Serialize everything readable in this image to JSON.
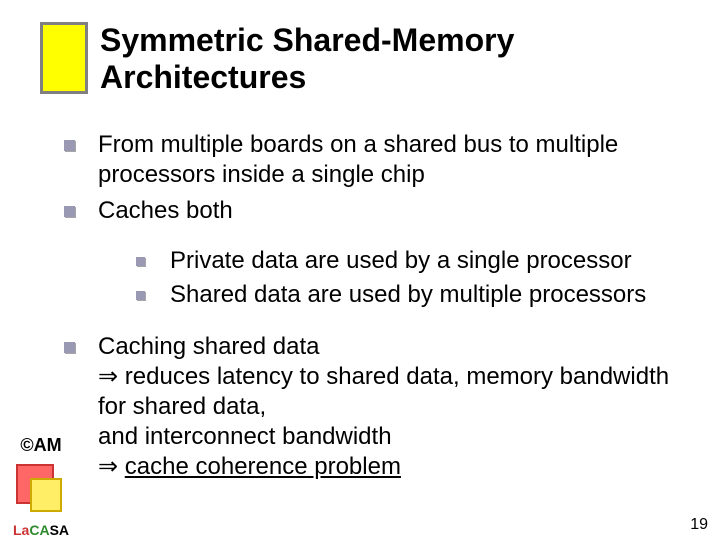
{
  "title": "Symmetric Shared-Memory Architectures",
  "bullets": {
    "b1": "From multiple boards on a shared bus to multiple processors inside a single chip",
    "b2": "Caches both",
    "b2a": "Private data are used by a single processor",
    "b2b": "Shared data are used by multiple processors",
    "b3_line1": "Caching shared data",
    "b3_line2_prefix": " reduces latency to shared data, memory bandwidth for shared data,",
    "b3_line3": "and interconnect bandwidth",
    "b3_line4_suffix": "cache coherence problem"
  },
  "arrow": "⇒",
  "footer": {
    "am": "©AM",
    "la": "La",
    "ca": "CA",
    "sa": "SA"
  },
  "page": "19"
}
